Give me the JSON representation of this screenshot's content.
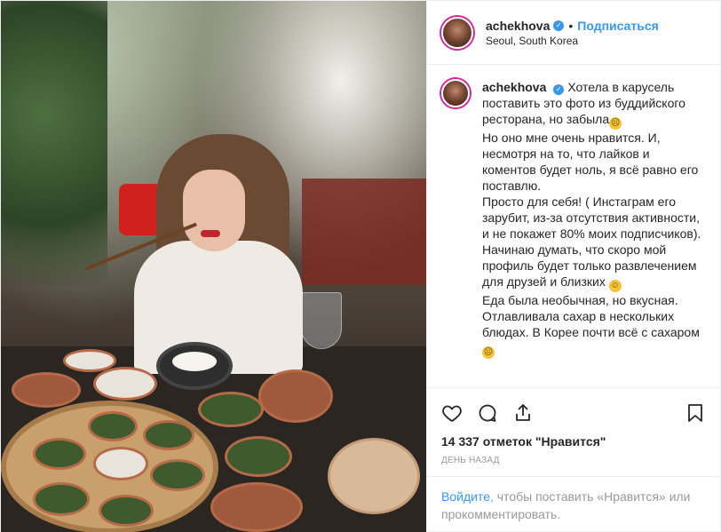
{
  "header": {
    "username": "achekhova",
    "verified_icon": "verified-badge-icon",
    "separator": "•",
    "follow_label": "Подписаться",
    "location": "Seoul, South Korea"
  },
  "caption": {
    "username": "achekhova",
    "lines": [
      "Хотела в карусель поставить это фото из буддийского ресторана, но забыла",
      "Но оно мне очень нравится. И, несмотря на то, что лайков и коментов будет ноль, я всё равно его поставлю.",
      "Просто для себя! ( Инстаграм его зарубит, из-за отсутствия активности, и не покажет 80% моих подписчиков).",
      "Начинаю думать, что скоро мой профиль будет только развлечением для друзей и близких",
      "Еда была необычная, но вкусная. Отлавливала сахар в нескольких блюдах. В Корее почти всё с сахаром"
    ],
    "emoji": {
      "sad": "☹",
      "smile": "☺"
    }
  },
  "actions": {
    "icons": [
      "heart-icon",
      "comment-icon",
      "share-icon",
      "bookmark-icon"
    ],
    "likes": "14 337 отметок \"Нравится\"",
    "time": "ДЕНЬ НАЗАД"
  },
  "login": {
    "link": "Войдите",
    "rest": ", чтобы поставить «Нравится» или прокомментировать."
  },
  "colors": {
    "accent": "#3897f0",
    "text": "#262626",
    "muted": "#999999",
    "border": "#efefef"
  }
}
